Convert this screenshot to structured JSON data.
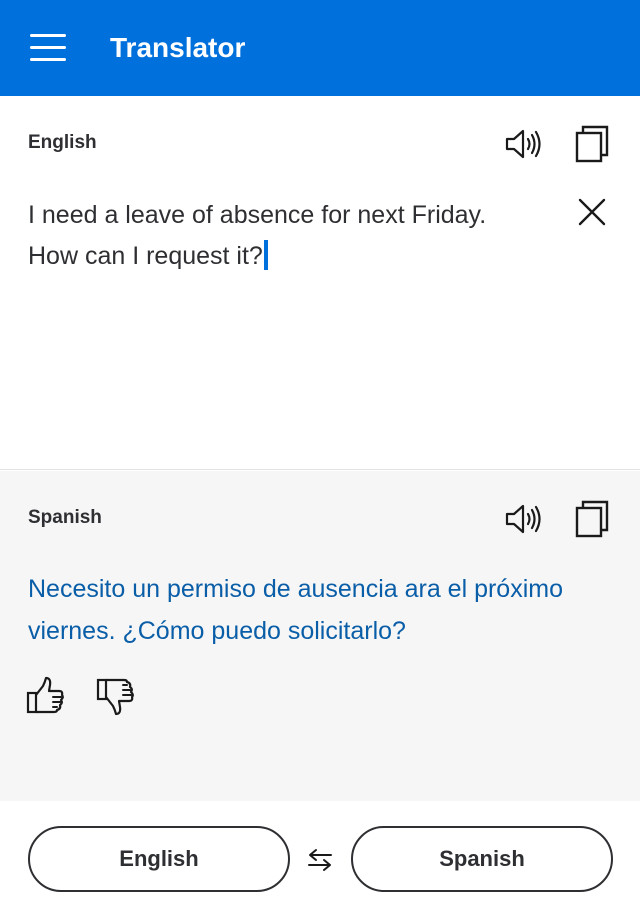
{
  "header": {
    "title": "Translator",
    "background_color": "#0071dc"
  },
  "source": {
    "language": "English",
    "text_line1": "I need a leave of absence for next Friday.",
    "text_line2": "How can I request it?",
    "icons": [
      "speaker-icon",
      "copy-icon",
      "close-icon"
    ]
  },
  "target": {
    "language": "Spanish",
    "text_line1": "Necesito un permiso de ausencia ara el próximo",
    "text_line2": "viernes. ¿Cómo puedo solicitarlo?",
    "text_color": "#0a5ea8",
    "icons": [
      "speaker-icon",
      "copy-icon",
      "thumbs-up-icon",
      "thumbs-down-icon"
    ]
  },
  "footer": {
    "from_language": "English",
    "to_language": "Spanish",
    "swap_icon": "swap-arrows-icon"
  }
}
